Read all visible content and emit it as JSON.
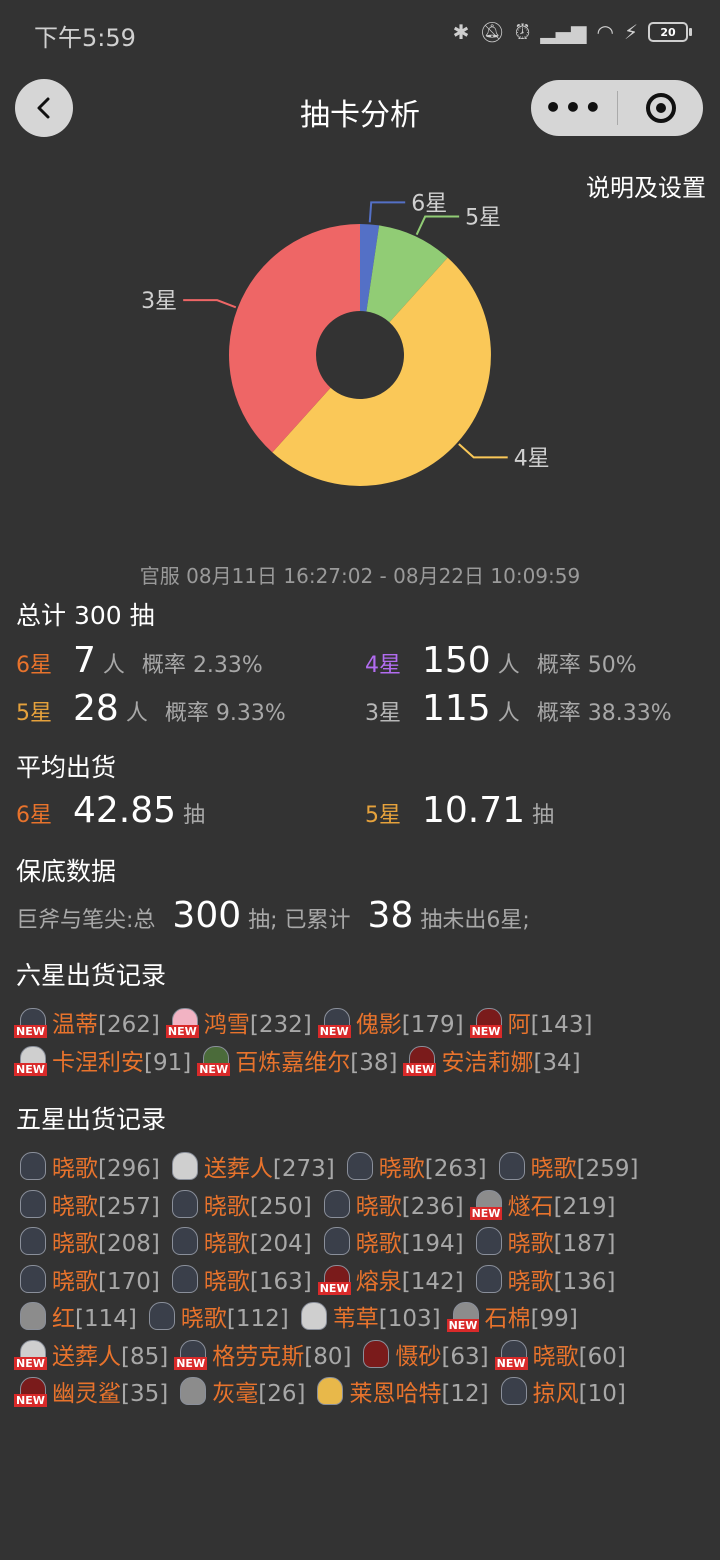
{
  "status_bar": {
    "time": "下午5:59",
    "battery": "20"
  },
  "nav": {
    "title": "抽卡分析"
  },
  "settings_link": "说明及设置",
  "chart_data": {
    "type": "pie",
    "donut": true,
    "series": [
      {
        "name": "6星",
        "value": 7,
        "color": "#5470c6"
      },
      {
        "name": "5星",
        "value": 28,
        "color": "#91cc75"
      },
      {
        "name": "4星",
        "value": 150,
        "color": "#fac858"
      },
      {
        "name": "3星",
        "value": 115,
        "color": "#ee6666"
      }
    ]
  },
  "period": "官服  08月11日 16:27:02  -  08月22日 10:09:59",
  "summary": {
    "title": "总计 300 抽",
    "person_unit": "人",
    "prob_label": "概率",
    "six": {
      "label": "6星",
      "count": "7",
      "prob": "2.33%"
    },
    "four": {
      "label": "4星",
      "count": "150",
      "prob": "50%"
    },
    "five": {
      "label": "5星",
      "count": "28",
      "prob": "9.33%"
    },
    "three": {
      "label": "3星",
      "count": "115",
      "prob": "38.33%"
    }
  },
  "average": {
    "title": "平均出货",
    "unit": "抽",
    "six": {
      "label": "6星",
      "value": "42.85"
    },
    "five": {
      "label": "5星",
      "value": "10.71"
    }
  },
  "pity": {
    "title": "保底数据",
    "pool_label": "巨斧与笔尖:总",
    "total": "300",
    "mid_text": "抽;  已累计",
    "since": "38",
    "tail_text": "抽未出6星;"
  },
  "new_tag": "NEW",
  "six_star_records": {
    "title": "六星出货记录",
    "items": [
      {
        "name": "温蒂",
        "count": "[262]",
        "new": true,
        "face": ""
      },
      {
        "name": "鸿雪",
        "count": "[232]",
        "new": true,
        "face": "pink"
      },
      {
        "name": "傀影",
        "count": "[179]",
        "new": true,
        "face": ""
      },
      {
        "name": "阿",
        "count": "[143]",
        "new": true,
        "face": "red"
      },
      {
        "name": "卡涅利安",
        "count": "[91]",
        "new": true,
        "face": "light"
      },
      {
        "name": "百炼嘉维尔",
        "count": "[38]",
        "new": true,
        "face": "green"
      },
      {
        "name": "安洁莉娜",
        "count": "[34]",
        "new": true,
        "face": "red"
      }
    ]
  },
  "five_star_records": {
    "title": "五星出货记录",
    "items": [
      {
        "name": "晓歌",
        "count": "[296]",
        "new": false,
        "face": ""
      },
      {
        "name": "送葬人",
        "count": "[273]",
        "new": false,
        "face": "light"
      },
      {
        "name": "晓歌",
        "count": "[263]",
        "new": false,
        "face": ""
      },
      {
        "name": "晓歌",
        "count": "[259]",
        "new": false,
        "face": ""
      },
      {
        "name": "晓歌",
        "count": "[257]",
        "new": false,
        "face": ""
      },
      {
        "name": "晓歌",
        "count": "[250]",
        "new": false,
        "face": ""
      },
      {
        "name": "晓歌",
        "count": "[236]",
        "new": false,
        "face": ""
      },
      {
        "name": "燧石",
        "count": "[219]",
        "new": true,
        "face": "gray"
      },
      {
        "name": "晓歌",
        "count": "[208]",
        "new": false,
        "face": ""
      },
      {
        "name": "晓歌",
        "count": "[204]",
        "new": false,
        "face": ""
      },
      {
        "name": "晓歌",
        "count": "[194]",
        "new": false,
        "face": ""
      },
      {
        "name": "晓歌",
        "count": "[187]",
        "new": false,
        "face": ""
      },
      {
        "name": "晓歌",
        "count": "[170]",
        "new": false,
        "face": ""
      },
      {
        "name": "晓歌",
        "count": "[163]",
        "new": false,
        "face": ""
      },
      {
        "name": "熔泉",
        "count": "[142]",
        "new": true,
        "face": "red"
      },
      {
        "name": "晓歌",
        "count": "[136]",
        "new": false,
        "face": ""
      },
      {
        "name": "红",
        "count": "[114]",
        "new": false,
        "face": "gray"
      },
      {
        "name": "晓歌",
        "count": "[112]",
        "new": false,
        "face": ""
      },
      {
        "name": "苇草",
        "count": "[103]",
        "new": false,
        "face": "light"
      },
      {
        "name": "石棉",
        "count": "[99]",
        "new": true,
        "face": "gray"
      },
      {
        "name": "送葬人",
        "count": "[85]",
        "new": true,
        "face": "light"
      },
      {
        "name": "格劳克斯",
        "count": "[80]",
        "new": true,
        "face": ""
      },
      {
        "name": "慑砂",
        "count": "[63]",
        "new": false,
        "face": "red"
      },
      {
        "name": "晓歌",
        "count": "[60]",
        "new": true,
        "face": ""
      },
      {
        "name": "幽灵鲨",
        "count": "[35]",
        "new": true,
        "face": "red"
      },
      {
        "name": "灰毫",
        "count": "[26]",
        "new": false,
        "face": "gray"
      },
      {
        "name": "莱恩哈特",
        "count": "[12]",
        "new": false,
        "face": "gold"
      },
      {
        "name": "掠风",
        "count": "[10]",
        "new": false,
        "face": ""
      }
    ]
  }
}
